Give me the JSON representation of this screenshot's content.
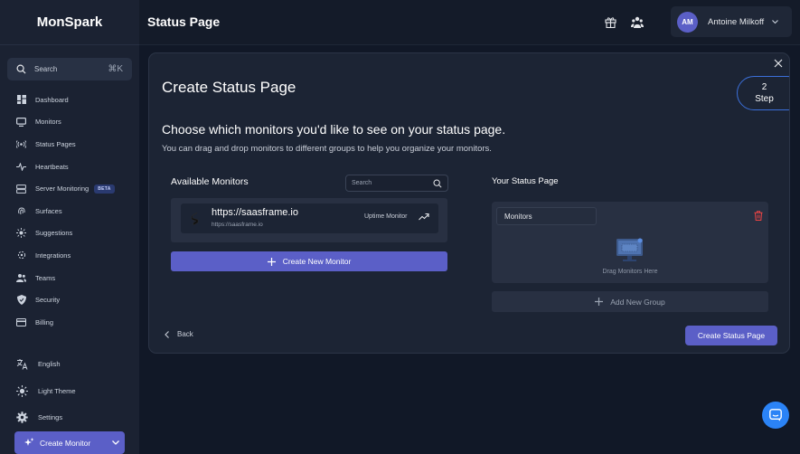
{
  "app": {
    "brand": "MonSpark",
    "page_title": "Status Page"
  },
  "sidebar": {
    "search": {
      "label": "Search",
      "shortcut": "⌘K"
    },
    "items": [
      {
        "label": "Dashboard",
        "icon": "dashboard-icon"
      },
      {
        "label": "Monitors",
        "icon": "monitor-icon"
      },
      {
        "label": "Status Pages",
        "icon": "broadcast-icon"
      },
      {
        "label": "Heartbeats",
        "icon": "pulse-icon"
      },
      {
        "label": "Server Monitoring",
        "icon": "server-icon",
        "badge": "BETA"
      },
      {
        "label": "Surfaces",
        "icon": "fingerprint-icon"
      },
      {
        "label": "Suggestions",
        "icon": "sun-icon"
      },
      {
        "label": "Integrations",
        "icon": "puzzle-icon"
      },
      {
        "label": "Teams",
        "icon": "users-icon"
      },
      {
        "label": "Security",
        "icon": "shield-icon"
      },
      {
        "label": "Billing",
        "icon": "credit-card-icon"
      }
    ],
    "bottom": [
      {
        "label": "English",
        "icon": "translate-icon"
      },
      {
        "label": "Light Theme",
        "icon": "sun-icon"
      },
      {
        "label": "Settings",
        "icon": "gear-icon"
      }
    ],
    "create_monitor": "Create Monitor"
  },
  "user": {
    "initials": "AM",
    "name": "Antoine Milkoff"
  },
  "modal": {
    "title": "Create Status Page",
    "step_number": "2",
    "step_label": "Step",
    "subheading": "Choose which monitors you'd like to see on your status page.",
    "description": "You can drag and drop monitors to different groups to help you organize your monitors.",
    "available": {
      "title": "Available Monitors",
      "search_placeholder": "Search",
      "monitors": [
        {
          "name": "https://saasframe.io",
          "url": "https://saasframe.io",
          "type": "Uptime Monitor"
        }
      ],
      "create_button": "Create New Monitor"
    },
    "status_page": {
      "title": "Your Status Page",
      "group_name": "Monitors",
      "drop_text": "Drag Monitors Here",
      "add_group": "Add New Group"
    },
    "back": "Back",
    "submit": "Create Status Page"
  },
  "colors": {
    "accent": "#5b5fc7",
    "background": "#111827",
    "panel": "#1c2434",
    "danger": "#ef4444",
    "chat": "#2b83f6"
  }
}
